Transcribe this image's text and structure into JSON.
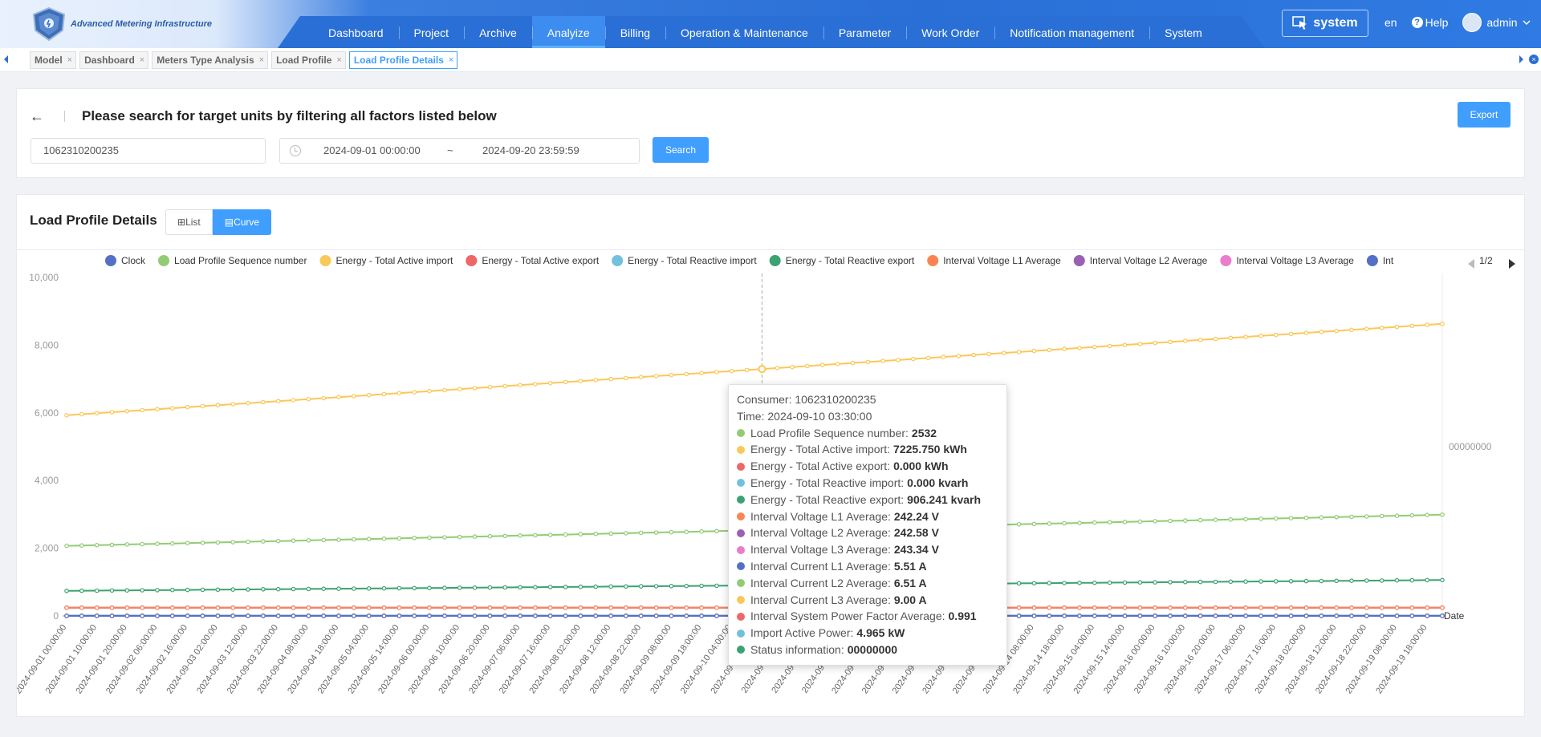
{
  "header": {
    "logo_text": "Advanced Metering Infrastructure",
    "nav": [
      {
        "label": "Dashboard",
        "active": false
      },
      {
        "label": "Project",
        "active": false
      },
      {
        "label": "Archive",
        "active": false
      },
      {
        "label": "Analyize",
        "active": true
      },
      {
        "label": "Billing",
        "active": false
      },
      {
        "label": "Operation & Maintenance",
        "active": false
      },
      {
        "label": "Parameter",
        "active": false
      },
      {
        "label": "Work Order",
        "active": false
      },
      {
        "label": "Notification management",
        "active": false
      },
      {
        "label": "System",
        "active": false
      }
    ],
    "system_button": "system",
    "lang": "en",
    "help": "Help",
    "user": "admin"
  },
  "tabs": [
    {
      "label": "Model",
      "active": false
    },
    {
      "label": "Dashboard",
      "active": false
    },
    {
      "label": "Meters Type Analysis",
      "active": false
    },
    {
      "label": "Load Profile",
      "active": false
    },
    {
      "label": "Load Profile Details",
      "active": true
    }
  ],
  "search": {
    "back": "←",
    "title": "Please search for target units by filtering all factors listed below",
    "consumer_value": "1062310200235",
    "date_start": "2024-09-01 00:00:00",
    "date_sep": "~",
    "date_end": "2024-09-20 23:59:59",
    "search_label": "Search",
    "export_label": "Export"
  },
  "chart_panel": {
    "title": "Load Profile Details",
    "view_list": "List",
    "view_curve": "Curve",
    "legend_page": "1/2"
  },
  "chart_data": {
    "type": "line",
    "x_start": "2024-09-01 00:00",
    "x_step_hours": 5,
    "x_count": 92,
    "xlabel": "Date",
    "ylim": [
      0,
      10000
    ],
    "yticks": [
      "0",
      "2,000",
      "4,000",
      "6,000",
      "8,000",
      "10,000"
    ],
    "right_axis_label": "00000000",
    "series": [
      {
        "name": "Clock",
        "color": "#5470c6",
        "start": 0,
        "end": 0,
        "legend": true
      },
      {
        "name": "Load Profile Sequence number",
        "color": "#91cc75",
        "start": 2070,
        "end": 2990,
        "legend": true
      },
      {
        "name": "Energy - Total Active import",
        "color": "#fac858",
        "start": 5930,
        "end": 8630,
        "legend": true
      },
      {
        "name": "Energy - Total Active export",
        "color": "#ee6666",
        "start": 0,
        "end": 0,
        "legend": true
      },
      {
        "name": "Energy - Total Reactive import",
        "color": "#73c0de",
        "start": 0,
        "end": 0,
        "legend": true
      },
      {
        "name": "Energy - Total Reactive export",
        "color": "#3ba272",
        "start": 740,
        "end": 1060,
        "legend": true
      },
      {
        "name": "Interval Voltage L1 Average",
        "color": "#fc8452",
        "start": 242,
        "end": 242,
        "legend": true
      },
      {
        "name": "Interval Voltage L2 Average",
        "color": "#9a60b4",
        "start": 243,
        "end": 243,
        "legend": true
      },
      {
        "name": "Interval Voltage L3 Average",
        "color": "#ea7ccc",
        "start": 243,
        "end": 243,
        "legend": true
      },
      {
        "name": "Interval Current L1 Average",
        "color": "#5470c6",
        "start": 5,
        "end": 5,
        "legend": false
      },
      {
        "name": "Interval Current L2 Average",
        "color": "#91cc75",
        "start": 6,
        "end": 6,
        "legend": false
      },
      {
        "name": "Interval Current L3 Average",
        "color": "#fac858",
        "start": 9,
        "end": 9,
        "legend": false
      },
      {
        "name": "Interval System Power Factor Average",
        "color": "#ee6666",
        "start": 1,
        "end": 1,
        "legend": false
      },
      {
        "name": "Import Active Power",
        "color": "#73c0de",
        "start": 5,
        "end": 5,
        "legend": false
      }
    ],
    "legend_truncated": "Int",
    "hover_index": 46
  },
  "tooltip": {
    "consumer": "Consumer: 1062310200235",
    "time": "Time: 2024-09-10 03:30:00",
    "rows": [
      {
        "label": "Load Profile Sequence number:",
        "value": "2532",
        "color": "#91cc75"
      },
      {
        "label": "Energy - Total Active import:",
        "value": "7225.750 kWh",
        "color": "#fac858"
      },
      {
        "label": "Energy - Total Active export:",
        "value": "0.000 kWh",
        "color": "#ee6666"
      },
      {
        "label": "Energy - Total Reactive import:",
        "value": "0.000 kvarh",
        "color": "#73c0de"
      },
      {
        "label": "Energy - Total Reactive export:",
        "value": "906.241 kvarh",
        "color": "#3ba272"
      },
      {
        "label": "Interval Voltage L1 Average:",
        "value": "242.24 V",
        "color": "#fc8452"
      },
      {
        "label": "Interval Voltage L2 Average:",
        "value": "242.58 V",
        "color": "#9a60b4"
      },
      {
        "label": "Interval Voltage L3 Average:",
        "value": "243.34 V",
        "color": "#ea7ccc"
      },
      {
        "label": "Interval Current L1 Average:",
        "value": "5.51 A",
        "color": "#5470c6"
      },
      {
        "label": "Interval Current L2 Average:",
        "value": "6.51 A",
        "color": "#91cc75"
      },
      {
        "label": "Interval Current L3 Average:",
        "value": "9.00 A",
        "color": "#fac858"
      },
      {
        "label": "Interval System Power Factor Average:",
        "value": "0.991",
        "color": "#ee6666"
      },
      {
        "label": "Import Active Power:",
        "value": "4.965 kW",
        "color": "#73c0de"
      },
      {
        "label": "Status information:",
        "value": "00000000",
        "color": "#3ba272"
      }
    ]
  }
}
